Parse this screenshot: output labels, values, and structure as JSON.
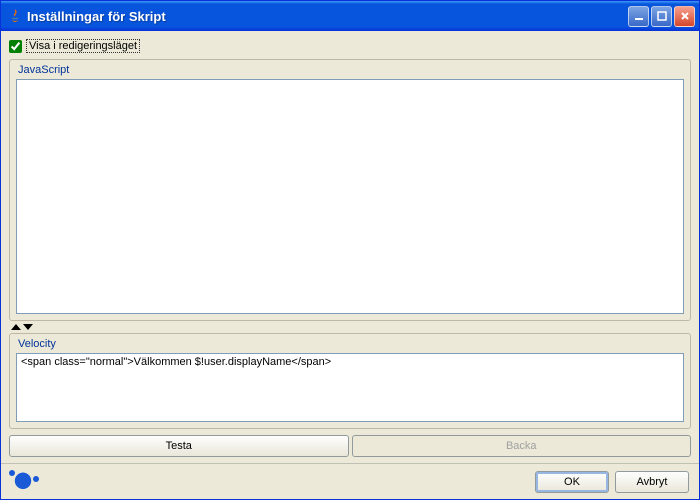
{
  "window": {
    "title": "Inställningar för Skript"
  },
  "checkbox": {
    "label": "Visa i redigeringsläget",
    "checked": true
  },
  "groups": {
    "javascript": {
      "title": "JavaScript",
      "value": ""
    },
    "velocity": {
      "title": "Velocity",
      "value": "<span class=\"normal\">Välkommen $!user.displayName</span>"
    }
  },
  "buttons": {
    "test": "Testa",
    "back": "Backa",
    "ok": "OK",
    "cancel": "Avbryt"
  },
  "backDisabled": true
}
